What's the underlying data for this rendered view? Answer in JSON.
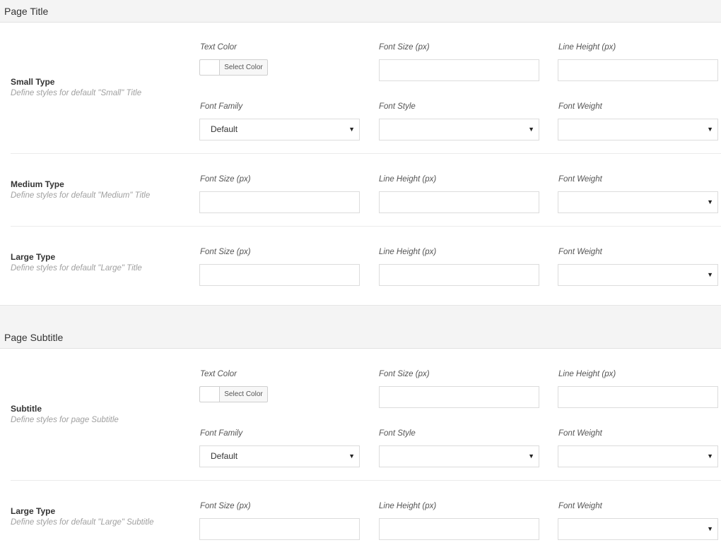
{
  "sections": [
    {
      "title": "Page Title",
      "rows": [
        {
          "title": "Small Type",
          "desc": "Define styles for default \"Small\" Title",
          "text_color_label": "Text Color",
          "select_color": "Select Color",
          "font_size_label": "Font Size (px)",
          "line_height_label": "Line Height (px)",
          "font_family_label": "Font Family",
          "font_family_value": "Default",
          "font_style_label": "Font Style",
          "font_weight_label": "Font Weight"
        },
        {
          "title": "Medium Type",
          "desc": "Define styles for default \"Medium\" Title",
          "font_size_label": "Font Size (px)",
          "line_height_label": "Line Height (px)",
          "font_weight_label": "Font Weight"
        },
        {
          "title": "Large Type",
          "desc": "Define styles for default \"Large\" Title",
          "font_size_label": "Font Size (px)",
          "line_height_label": "Line Height (px)",
          "font_weight_label": "Font Weight"
        }
      ]
    },
    {
      "title": "Page Subtitle",
      "rows": [
        {
          "title": "Subtitle",
          "desc": "Define styles for page Subtitle",
          "text_color_label": "Text Color",
          "select_color": "Select Color",
          "font_size_label": "Font Size (px)",
          "line_height_label": "Line Height (px)",
          "font_family_label": "Font Family",
          "font_family_value": "Default",
          "font_style_label": "Font Style",
          "font_weight_label": "Font Weight"
        },
        {
          "title": "Large Type",
          "desc": "Define styles for default \"Large\" Subtitle",
          "font_size_label": "Font Size (px)",
          "line_height_label": "Line Height (px)",
          "font_weight_label": "Font Weight"
        }
      ]
    }
  ],
  "icons": {
    "dropdown": "caret-down-icon"
  },
  "colors": {
    "header_bg": "#f4f4f4",
    "border": "#dcdcdc",
    "desc_text": "#a0a0a0"
  }
}
